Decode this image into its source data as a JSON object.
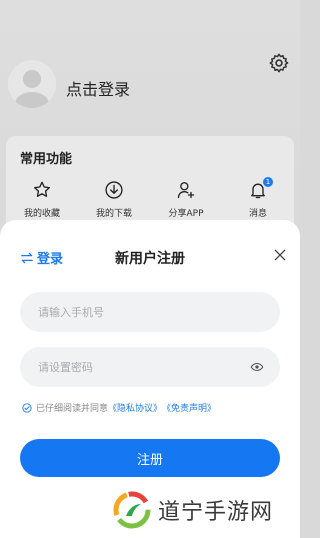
{
  "profile": {
    "login_prompt": "点击登录"
  },
  "features": {
    "title": "常用功能",
    "items": [
      {
        "label": "我的收藏",
        "icon": "star-icon"
      },
      {
        "label": "我的下载",
        "icon": "download-icon"
      },
      {
        "label": "分享APP",
        "icon": "add-user-icon"
      },
      {
        "label": "消息",
        "icon": "bell-icon",
        "badge": "1"
      }
    ]
  },
  "dialog": {
    "switch_label": "登录",
    "title": "新用户注册",
    "phone_placeholder": "请输入手机号",
    "password_placeholder": "请设置密码",
    "agreement_prefix": "已仔细阅读并同意",
    "privacy_link": "《隐私协议》",
    "disclaimer_link": "《免责声明》",
    "register_label": "注册"
  },
  "watermark": {
    "text": "道宁手游网"
  },
  "colors": {
    "accent": "#1677f2",
    "link": "#1e7bea"
  }
}
